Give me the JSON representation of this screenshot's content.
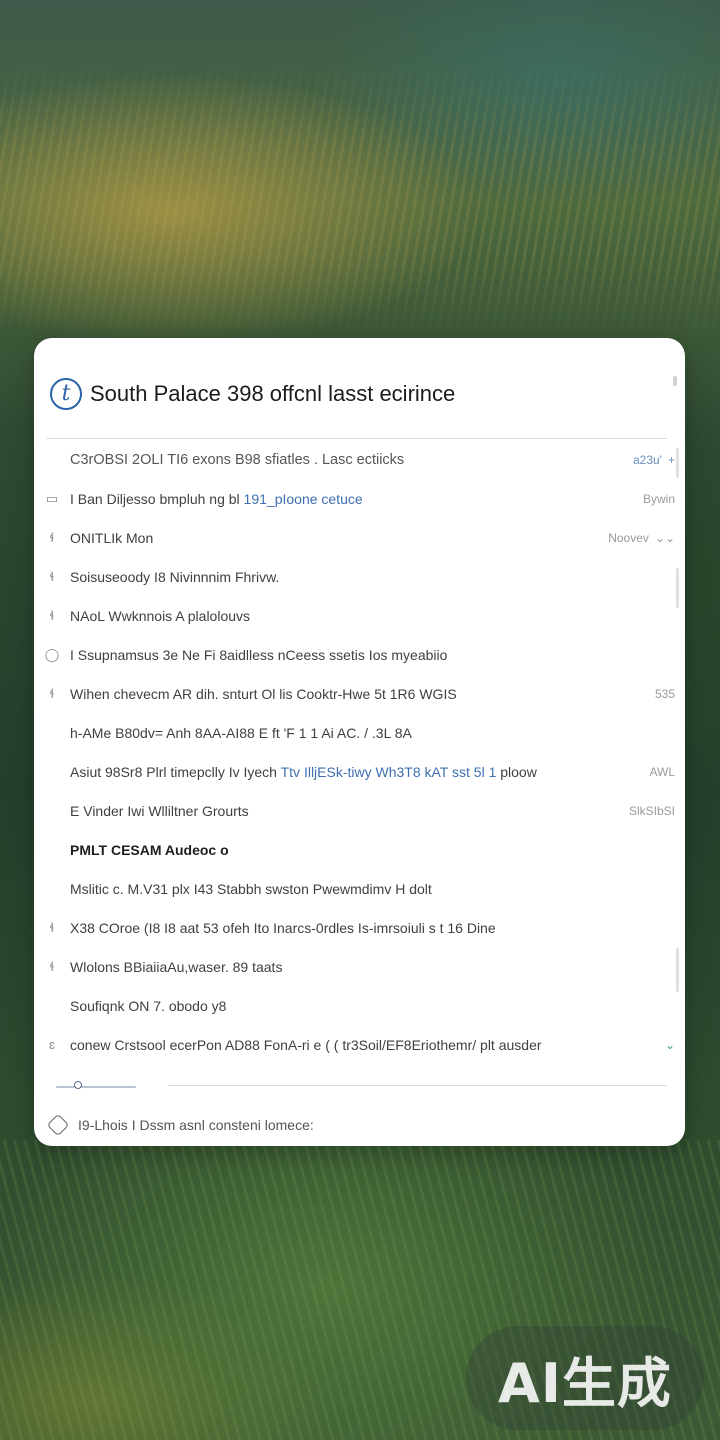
{
  "card": {
    "logo_glyph": "t",
    "title": "South Palace 398 offcnl lasst ecirince",
    "rows": [
      {
        "lead": "",
        "text": "C3rOBSI 2OLI TI6 exons B98 sfiatles . Lasc ectiicks",
        "right": "a23u'",
        "right_icon": "+"
      },
      {
        "lead": "▭",
        "text": "I Ban Diljesso bmpluh ng bl",
        "link": "191_pIoone cetuce",
        "right": "Bywin",
        "right_icon": ""
      },
      {
        "lead": "ɬ",
        "text": "ONITLIk  Mon",
        "right": "Noovev",
        "right_icon": "⌄⌄"
      },
      {
        "lead": "ɬ",
        "text": "Soisuseoody I8 Nivinnnim Fhrivw.",
        "right": "",
        "right_icon": ""
      },
      {
        "lead": "ɬ",
        "text": "NAoL Wwknnois A plalolouvs",
        "right": "",
        "right_icon": ""
      },
      {
        "lead": "◯",
        "text": "I Ssupnamsus 3e Ne Fi 8aidlless  nCeess ssetis Ios myeabiio",
        "right": "",
        "right_icon": ""
      },
      {
        "lead": "ɬ",
        "text": "Wihen chevecm AR dih. snturt Ol lis Cooktr-Hwe 5t 1R6 WGIS",
        "right": "535",
        "right_icon": ""
      },
      {
        "lead": "",
        "text": "h-AMe B80dv= Anh 8AA-AI88 E ft 'F 1 1 Ai AC. / .3L 8A",
        "right": "",
        "right_icon": ""
      },
      {
        "lead": "",
        "text": "Asiut 98Sr8 Plrl timepclly Iv Iyech",
        "link": "Ttv IlljESk-tiwy Wh3T8 kAT sst 5l 1",
        "text2": "ploow",
        "right": "AWL",
        "right_icon": ""
      },
      {
        "lead": "",
        "text": "E  Vinder Iwi Wlliltner Grourts",
        "right": "SlkSIbSI",
        "right_icon": ""
      },
      {
        "lead": "",
        "text": "PMLT CESAM  Audeoc o",
        "bold": true,
        "right": "",
        "right_icon": ""
      },
      {
        "lead": "",
        "text": "Mslitic c.  M.V31 plx I43 Stabbh  swston Pwewmdimv H dolt",
        "right": "",
        "right_icon": ""
      },
      {
        "lead": "ɬ",
        "text": "X38 COroe (I8 I8 aat 53 ofeh Ito Inarcs-0rdles Is-imrsoiuli s t 16 Dine",
        "right": "",
        "right_icon": ""
      },
      {
        "lead": "ɬ",
        "text": "Wlolons BBiaiiaAu,waser. 89 taats",
        "right": "",
        "right_icon": ""
      },
      {
        "lead": "",
        "text": "Soufiqnk ON 7. obodo y8",
        "right": "",
        "right_icon": ""
      },
      {
        "lead": "ɛ",
        "text": "conew Crstsool ecerPon AD88 FonA-ri e ( ( tr3Soil/EF8Eriothemr/ plt ausder",
        "right": "",
        "right_icon": "⌄"
      }
    ],
    "footer_text": "I9-Lhois I Dssm asnl consteni lomece:"
  },
  "badge": {
    "text": "AI生成"
  }
}
